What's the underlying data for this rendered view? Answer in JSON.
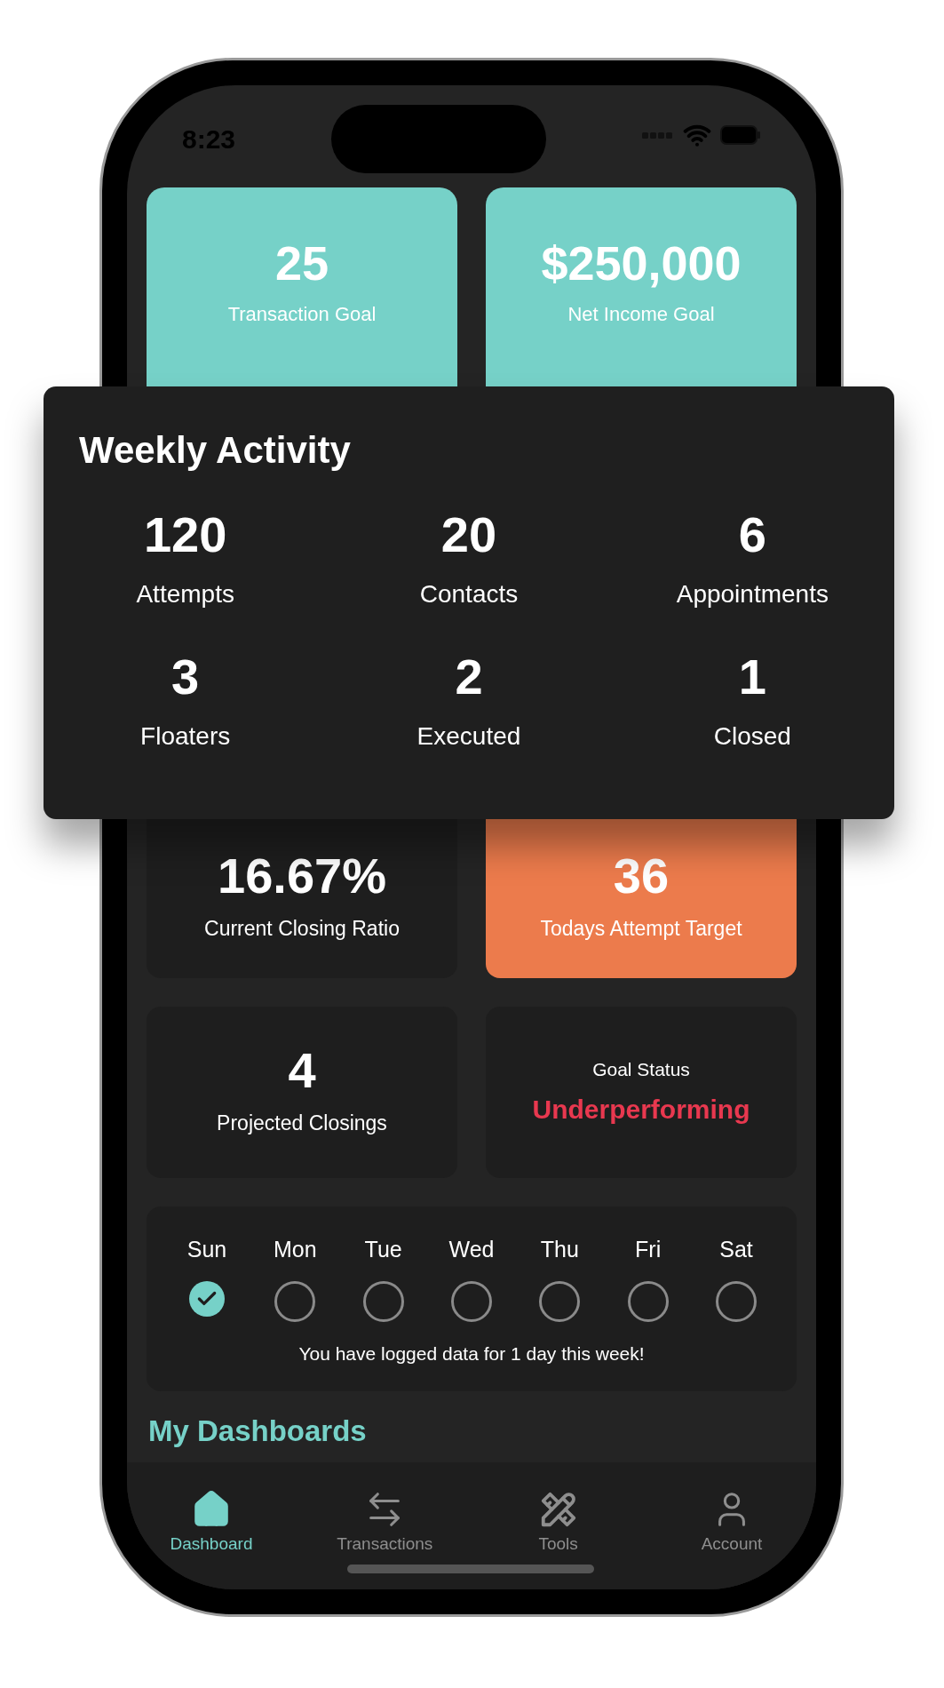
{
  "status_bar": {
    "time": "8:23"
  },
  "goal_cards": [
    {
      "value": "25",
      "label": "Transaction Goal",
      "color": "#76d1c8"
    },
    {
      "value": "$250,000",
      "label": "Net Income Goal",
      "color": "#76d1c8"
    }
  ],
  "weekly_activity": {
    "title": "Weekly Activity",
    "stats": [
      {
        "value": "120",
        "label": "Attempts"
      },
      {
        "value": "20",
        "label": "Contacts"
      },
      {
        "value": "6",
        "label": "Appointments"
      },
      {
        "value": "3",
        "label": "Floaters"
      },
      {
        "value": "2",
        "label": "Executed"
      },
      {
        "value": "1",
        "label": "Closed"
      }
    ]
  },
  "metric_cards": [
    {
      "kind": "metric",
      "value": "16.67%",
      "label": "Current Closing Ratio",
      "color": "#1e1e1e"
    },
    {
      "kind": "metric",
      "value": "36",
      "label": "Todays Attempt Target",
      "color": "#ec7b4c"
    },
    {
      "kind": "metric",
      "value": "4",
      "label": "Projected Closings",
      "color": "#1e1e1e"
    },
    {
      "kind": "status",
      "label": "Goal Status",
      "value": "Underperforming",
      "color": "#1e1e1e"
    }
  ],
  "week_log": {
    "days": [
      {
        "label": "Sun",
        "checked": true
      },
      {
        "label": "Mon",
        "checked": false
      },
      {
        "label": "Tue",
        "checked": false
      },
      {
        "label": "Wed",
        "checked": false
      },
      {
        "label": "Thu",
        "checked": false
      },
      {
        "label": "Fri",
        "checked": false
      },
      {
        "label": "Sat",
        "checked": false
      }
    ],
    "message": "You have logged data for 1 day this week!"
  },
  "section_title": "My Dashboards",
  "tab_bar": [
    {
      "label": "Dashboard",
      "selected": true
    },
    {
      "label": "Transactions",
      "selected": false
    },
    {
      "label": "Tools",
      "selected": false
    },
    {
      "label": "Account",
      "selected": false
    }
  ]
}
